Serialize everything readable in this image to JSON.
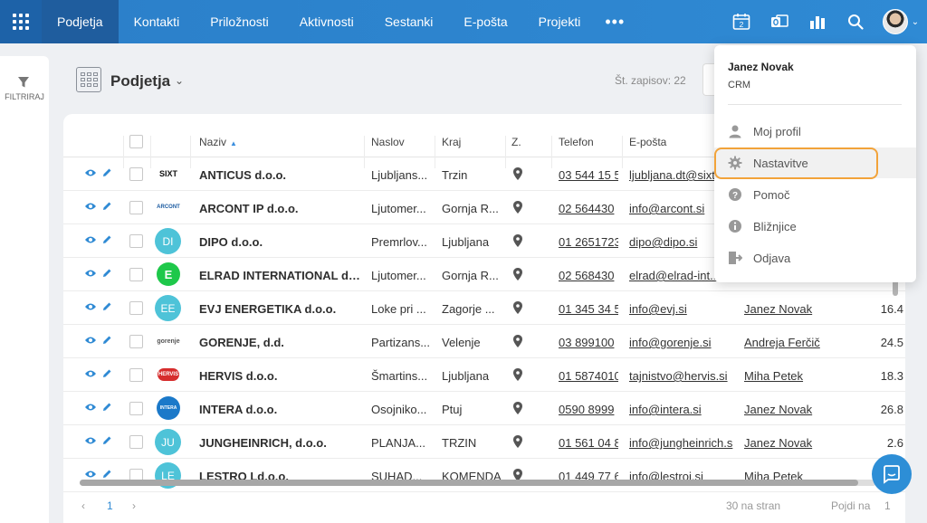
{
  "nav": {
    "items": [
      "Podjetja",
      "Kontakti",
      "Priložnosti",
      "Aktivnosti",
      "Sestanki",
      "E-pošta",
      "Projekti"
    ],
    "more": "•••",
    "calendar_badge": "2"
  },
  "sidebar": {
    "filter_label": "FILTRIRAJ"
  },
  "header": {
    "title": "Podjetja",
    "record_count": "Št. zapisov: 22"
  },
  "table": {
    "columns": [
      "Naziv",
      "Naslov",
      "Kraj",
      "Z.",
      "Telefon",
      "E-pošta"
    ],
    "rows": [
      {
        "logo": "SIXT",
        "name": "ANTICUS d.o.o.",
        "address": "Ljubljans...",
        "city": "Trzin",
        "phone": "03 544 15 5",
        "email": "ljubljana.dt@sixt",
        "owner": "",
        "amount": ""
      },
      {
        "logo": "ARCONT",
        "name": "ARCONT IP d.o.o.",
        "address": "Ljutomer...",
        "city": "Gornja R...",
        "phone": "02 564430",
        "email": "info@arcont.si",
        "owner": "",
        "amount": ""
      },
      {
        "logo": "DI",
        "name": "DIPO d.o.o.",
        "address": "Premrlov...",
        "city": "Ljubljana",
        "phone": "01 2651723",
        "email": "dipo@dipo.si",
        "owner": "",
        "amount": ""
      },
      {
        "logo": "E",
        "name": "ELRAD INTERNATIONAL d....",
        "address": "Ljutomer...",
        "city": "Gornja R...",
        "phone": "02 568430",
        "email": "elrad@elrad-int...",
        "owner": "",
        "amount": ""
      },
      {
        "logo": "EE",
        "name": "EVJ ENERGETIKA d.o.o.",
        "address": "Loke pri ...",
        "city": "Zagorje ...",
        "phone": "01 345 34 5",
        "email": "info@evj.si",
        "owner": "Janez Novak",
        "amount": "16.4"
      },
      {
        "logo": "gorenje",
        "name": "GORENJE, d.d.",
        "address": "Partizans...",
        "city": "Velenje",
        "phone": "03 899100",
        "email": "info@gorenje.si",
        "owner": "Andreja Ferčič",
        "amount": "24.5"
      },
      {
        "logo": "HERVIS",
        "name": "HERVIS d.o.o.",
        "address": "Šmartins...",
        "city": "Ljubljana",
        "phone": "01 5874010",
        "email": "tajnistvo@hervis.si",
        "owner": "Miha Petek",
        "amount": "18.3"
      },
      {
        "logo": "INTERA",
        "name": "INTERA d.o.o.",
        "address": "Osojniko...",
        "city": "Ptuj",
        "phone": "0590 8999",
        "email": "info@intera.si",
        "owner": "Janez Novak",
        "amount": "26.8"
      },
      {
        "logo": "JU",
        "name": "JUNGHEINRICH, d.o.o.",
        "address": "PLANJA...",
        "city": "TRZIN",
        "phone": "01 561 04 8",
        "email": "info@jungheinrich.s",
        "owner": "Janez Novak",
        "amount": "2.6"
      },
      {
        "logo": "LE",
        "name": "LESTRO Ld.o.o.",
        "address": "SUHAD...",
        "city": "KOMENDA",
        "phone": "01 449 77 6",
        "email": "info@lestroi.si",
        "owner": "Miha Petek",
        "amount": "1"
      }
    ]
  },
  "pager": {
    "prev": "‹",
    "page": "1",
    "next": "›",
    "per_page": "30 na stran",
    "goto_label": "Pojdi na",
    "goto_value": "1"
  },
  "menu": {
    "user_name": "Janez Novak",
    "app": "CRM",
    "items": [
      "Moj profil",
      "Nastavitve",
      "Pomoč",
      "Bližnjice",
      "Odjava"
    ]
  },
  "colors": {
    "nav_bg": "#2f8ad4",
    "nav_active": "#1f5d9e",
    "accent": "#2f8ad4",
    "highlight_ring": "#f2a33a",
    "initial_badge": "#4ec3d8"
  }
}
